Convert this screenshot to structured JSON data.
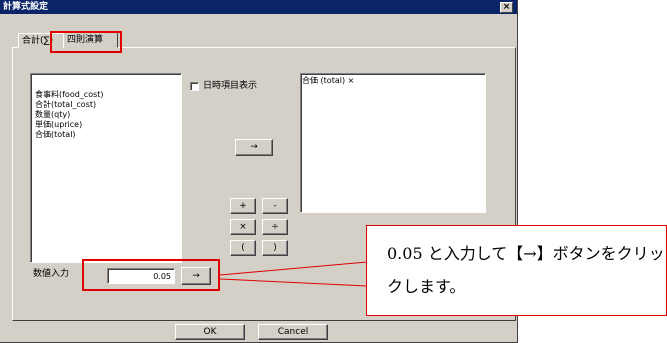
{
  "window": {
    "title": "計算式設定",
    "close_label": "×"
  },
  "tabs": [
    {
      "label": "合計(∑)"
    },
    {
      "label": "四則演算"
    }
  ],
  "field_list": {
    "items": [
      "食事料(food_cost)",
      "合計(total_cost)",
      "数量(qty)",
      "単価(uprice)",
      "合価(total)"
    ]
  },
  "show_date_items": {
    "label": "日時項目表示",
    "checked": false
  },
  "formula": {
    "text": "合価 (total) ×"
  },
  "buttons": {
    "arrow": "→",
    "plus": "+",
    "minus": "-",
    "multiply": "×",
    "divide": "÷",
    "open_paren": "(",
    "close_paren": ")",
    "num_arrow": "→",
    "ok": "OK",
    "cancel": "Cancel"
  },
  "numeric_input": {
    "label": "数値入力",
    "value": "0.05"
  },
  "callout": {
    "text": "0.05 と入力して【→】ボタンをクリックします。"
  },
  "colors": {
    "titlebar": "#0a246a",
    "dialog_bg": "#d4d0c8",
    "highlight": "#e00000"
  }
}
